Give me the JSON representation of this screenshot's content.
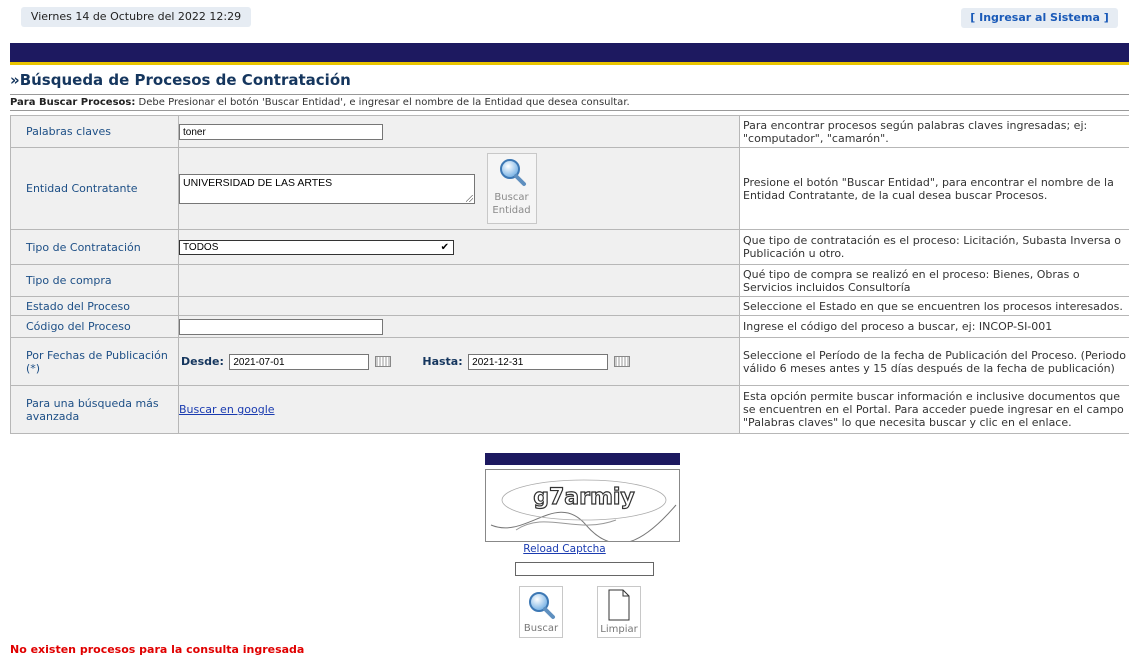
{
  "header": {
    "date": "Viernes 14 de Octubre del 2022 12:29",
    "login_link": "[ Ingresar al Sistema ]"
  },
  "page": {
    "title": "»Búsqueda de Procesos de Contratación",
    "info_bold": "Para Buscar Procesos:",
    "info_text": " Debe Presionar el botón 'Buscar Entidad', e ingresar el nombre de la Entidad que desea consultar."
  },
  "form": {
    "keywords": {
      "label": "Palabras claves",
      "value": "toner",
      "help": "Para encontrar procesos según palabras claves ingresadas; ej: \"computador\", \"camarón\"."
    },
    "entity": {
      "label": "Entidad Contratante",
      "value": "UNIVERSIDAD DE LAS ARTES",
      "button_line1": "Buscar",
      "button_line2": "Entidad",
      "help": "Presione el botón \"Buscar Entidad\", para encontrar el nombre de la Entidad Contratante, de la cual desea buscar Procesos."
    },
    "contract_type": {
      "label": "Tipo de Contratación",
      "selected": "TODOS",
      "help": "Que tipo de contratación es el proceso: Licitación, Subasta Inversa o Publicación u otro."
    },
    "purchase_type": {
      "label": "Tipo de compra",
      "help": "Qué tipo de compra se realizó en el proceso: Bienes, Obras o Servicios incluidos Consultoría"
    },
    "status": {
      "label": "Estado del Proceso",
      "help": "Seleccione el Estado en que se encuentren los procesos interesados."
    },
    "code": {
      "label": "Código del Proceso",
      "value": "",
      "help": "Ingrese el código del proceso a buscar, ej: INCOP-SI-001"
    },
    "dates": {
      "label": "Por Fechas de Publicación (*)",
      "from_label": "Desde:",
      "from_value": "2021-07-01",
      "to_label": "Hasta:",
      "to_value": "2021-12-31",
      "help": "Seleccione el Período de la fecha de Publicación del Proceso. (Periodo válido 6 meses antes y 15 días después de la fecha de publicación)"
    },
    "advanced": {
      "label": "Para una búsqueda más avanzada",
      "link": "Buscar en google",
      "help": "Esta opción permite buscar información e inclusive documentos que se encuentren en el Portal. Para acceder puede ingresar en el campo \"Palabras claves\" lo que necesita buscar y clic en el enlace."
    }
  },
  "captcha": {
    "text": "g7armiy",
    "reload": "Reload Captcha",
    "input_value": ""
  },
  "actions": {
    "search": "Buscar",
    "clear": "Limpiar"
  },
  "result_message": "No existen procesos para la consulta ingresada"
}
